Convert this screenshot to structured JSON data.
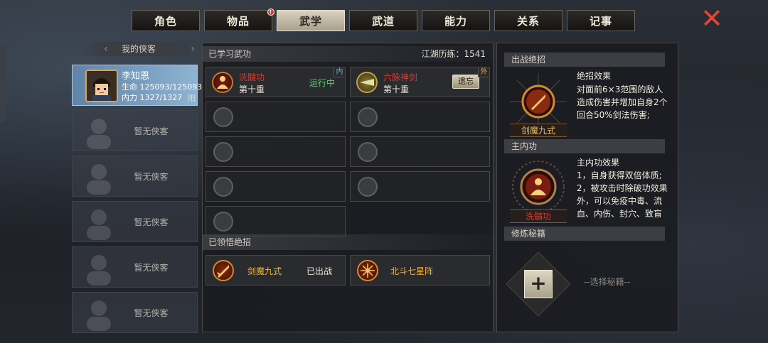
{
  "tabs": [
    {
      "label": "角色",
      "active": false
    },
    {
      "label": "物品",
      "active": false,
      "badge": "!"
    },
    {
      "label": "武学",
      "active": true
    },
    {
      "label": "武道",
      "active": false
    },
    {
      "label": "能力",
      "active": false
    },
    {
      "label": "关系",
      "active": false
    },
    {
      "label": "记事",
      "active": false
    }
  ],
  "left": {
    "title": "我的侠客",
    "companion": {
      "name": "李知恩",
      "hp": "生命 125093/125093",
      "mp": "内力 1327/1327",
      "affinity": "阳"
    },
    "empty_label": "暂无侠客"
  },
  "learned": {
    "heading": "已学习武功",
    "experience": "江湖历练：1541",
    "skills": [
      {
        "name": "洗髓功",
        "level": "第十重",
        "status": "运行中",
        "tag": "内"
      },
      {
        "name": "六脉神剑",
        "level": "第十重",
        "action": "遗忘",
        "tag": "外"
      }
    ]
  },
  "ultimates": {
    "heading": "已领悟绝招",
    "items": [
      {
        "name": "剑魔九式",
        "status": "已出战"
      },
      {
        "name": "北斗七星阵",
        "status": ""
      }
    ]
  },
  "right": {
    "battle_heading": "出战绝招",
    "battle_name": "剑魔九式",
    "battle_effect_title": "绝招效果",
    "battle_effect_text": "对面前6×3范围的敌人造成伤害并增加自身2个回合50%剑法伤害;",
    "main_heading": "主内功",
    "main_name": "洗髓功",
    "main_effect_title": "主内功效果",
    "main_effect_text": "1，自身获得双倍体质;\n2，被攻击时除破功效果外，可以免疫中毒、流血、内伤、封穴、致盲",
    "train_heading": "修炼秘籍",
    "choose_label": "--选择秘籍--",
    "add_label": "+"
  },
  "close_label": "✕",
  "colors": {
    "accent_gold": "#f0b43a",
    "running_green": "#55d86a",
    "skill_red": "#e0372a"
  }
}
